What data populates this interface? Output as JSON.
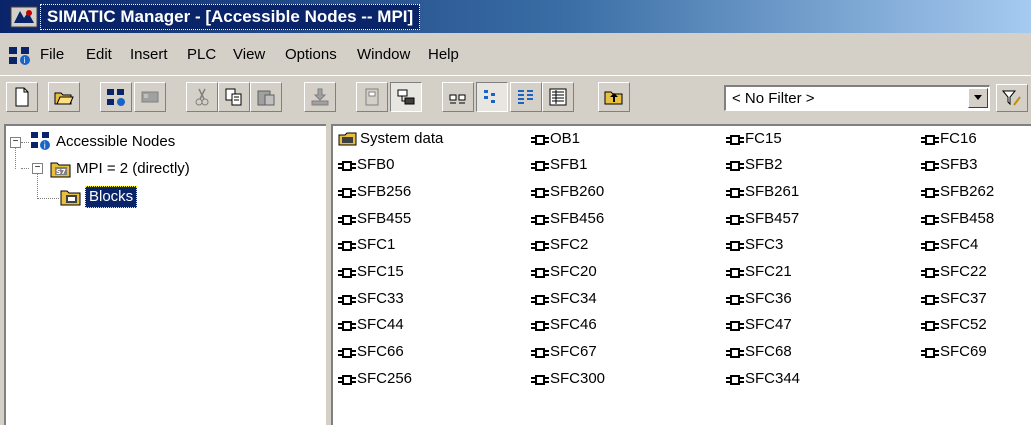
{
  "window": {
    "title": "SIMATIC Manager - [Accessible Nodes -- MPI]"
  },
  "menu": [
    "File",
    "Edit",
    "Insert",
    "PLC",
    "View",
    "Options",
    "Window",
    "Help"
  ],
  "toolbar": {
    "buttons": [
      "new-icon",
      "open-icon",
      "accessible-nodes-icon",
      "memory-card-icon",
      "cut-icon",
      "copy-icon",
      "paste-icon",
      "download-icon",
      "online-icon",
      "offline-icon",
      "large-icons-icon",
      "small-icons-icon",
      "list-icon",
      "details-icon",
      "up-one-level-icon"
    ],
    "filter_value": "< No Filter >"
  },
  "tree": {
    "root": "Accessible Nodes",
    "mpi": "MPI =  2 (directly)",
    "blocks": "Blocks"
  },
  "blocks": [
    "System data",
    "OB1",
    "FC15",
    "FC16",
    "SFB0",
    "SFB1",
    "SFB2",
    "SFB3",
    "SFB256",
    "SFB260",
    "SFB261",
    "SFB262",
    "SFB455",
    "SFB456",
    "SFB457",
    "SFB458",
    "SFC1",
    "SFC2",
    "SFC3",
    "SFC4",
    "SFC15",
    "SFC20",
    "SFC21",
    "SFC22",
    "SFC33",
    "SFC34",
    "SFC36",
    "SFC37",
    "SFC44",
    "SFC46",
    "SFC47",
    "SFC52",
    "SFC66",
    "SFC67",
    "SFC68",
    "SFC69",
    "SFC256",
    "SFC300",
    "SFC344"
  ],
  "colors": {
    "title_active": "#0a246a",
    "selection": "#0a246a",
    "face": "#d4d0c8"
  }
}
